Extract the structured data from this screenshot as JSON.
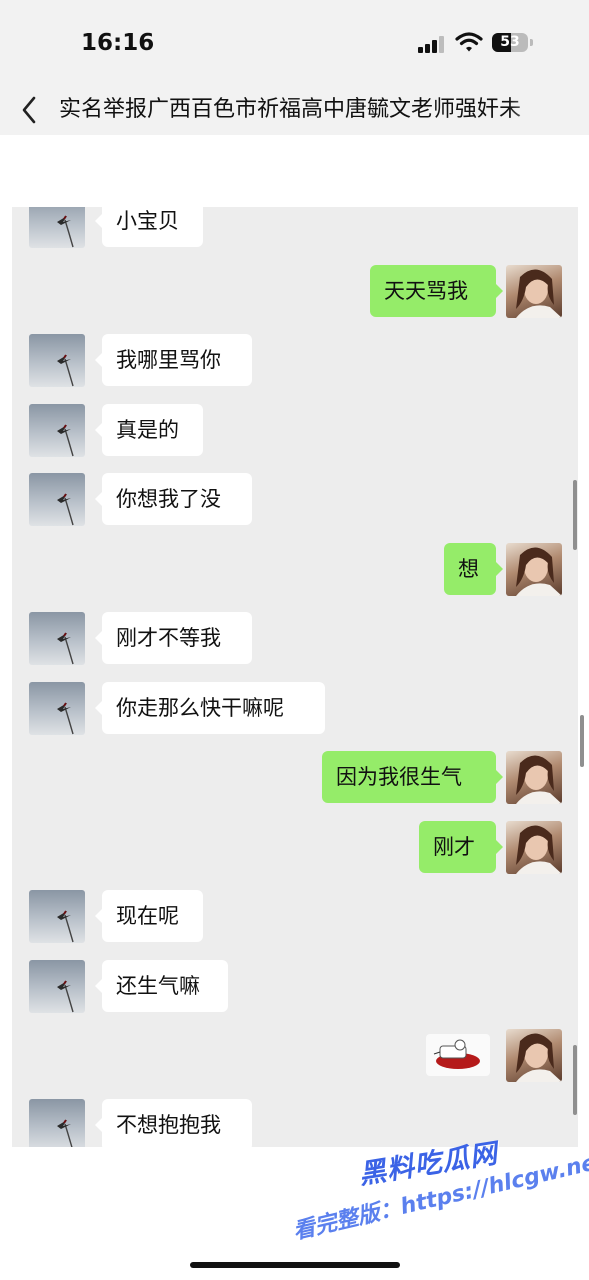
{
  "status_bar": {
    "time": "16:16",
    "battery": "53",
    "battery_level": 0.53
  },
  "nav": {
    "title": "实名举报广西百色市祈福高中唐毓文老师强奸未"
  },
  "messages": [
    {
      "side": "left",
      "text": "小宝贝"
    },
    {
      "side": "right",
      "text": "天天骂我"
    },
    {
      "side": "left",
      "text": "我哪里骂你"
    },
    {
      "side": "left",
      "text": "真是的"
    },
    {
      "side": "left",
      "text": "你想我了没"
    },
    {
      "side": "right",
      "text": "想"
    },
    {
      "side": "left",
      "text": "刚才不等我"
    },
    {
      "side": "left",
      "text": "你走那么快干嘛呢"
    },
    {
      "side": "right",
      "text": "因为我很生气"
    },
    {
      "side": "right",
      "text": "刚才"
    },
    {
      "side": "left",
      "text": "现在呢"
    },
    {
      "side": "left",
      "text": "还生气嘛"
    },
    {
      "side": "right",
      "text": "",
      "type": "sticker"
    },
    {
      "side": "left",
      "text": "不想抱抱我"
    }
  ],
  "watermark": {
    "line1": "黑料吃瓜网",
    "line2": "看完整版：https://hlcgw.net"
  },
  "colors": {
    "sent_bubble": "#95ec69",
    "received_bubble": "#ffffff",
    "chat_bg": "#ededed",
    "watermark": "#3b63e6"
  }
}
